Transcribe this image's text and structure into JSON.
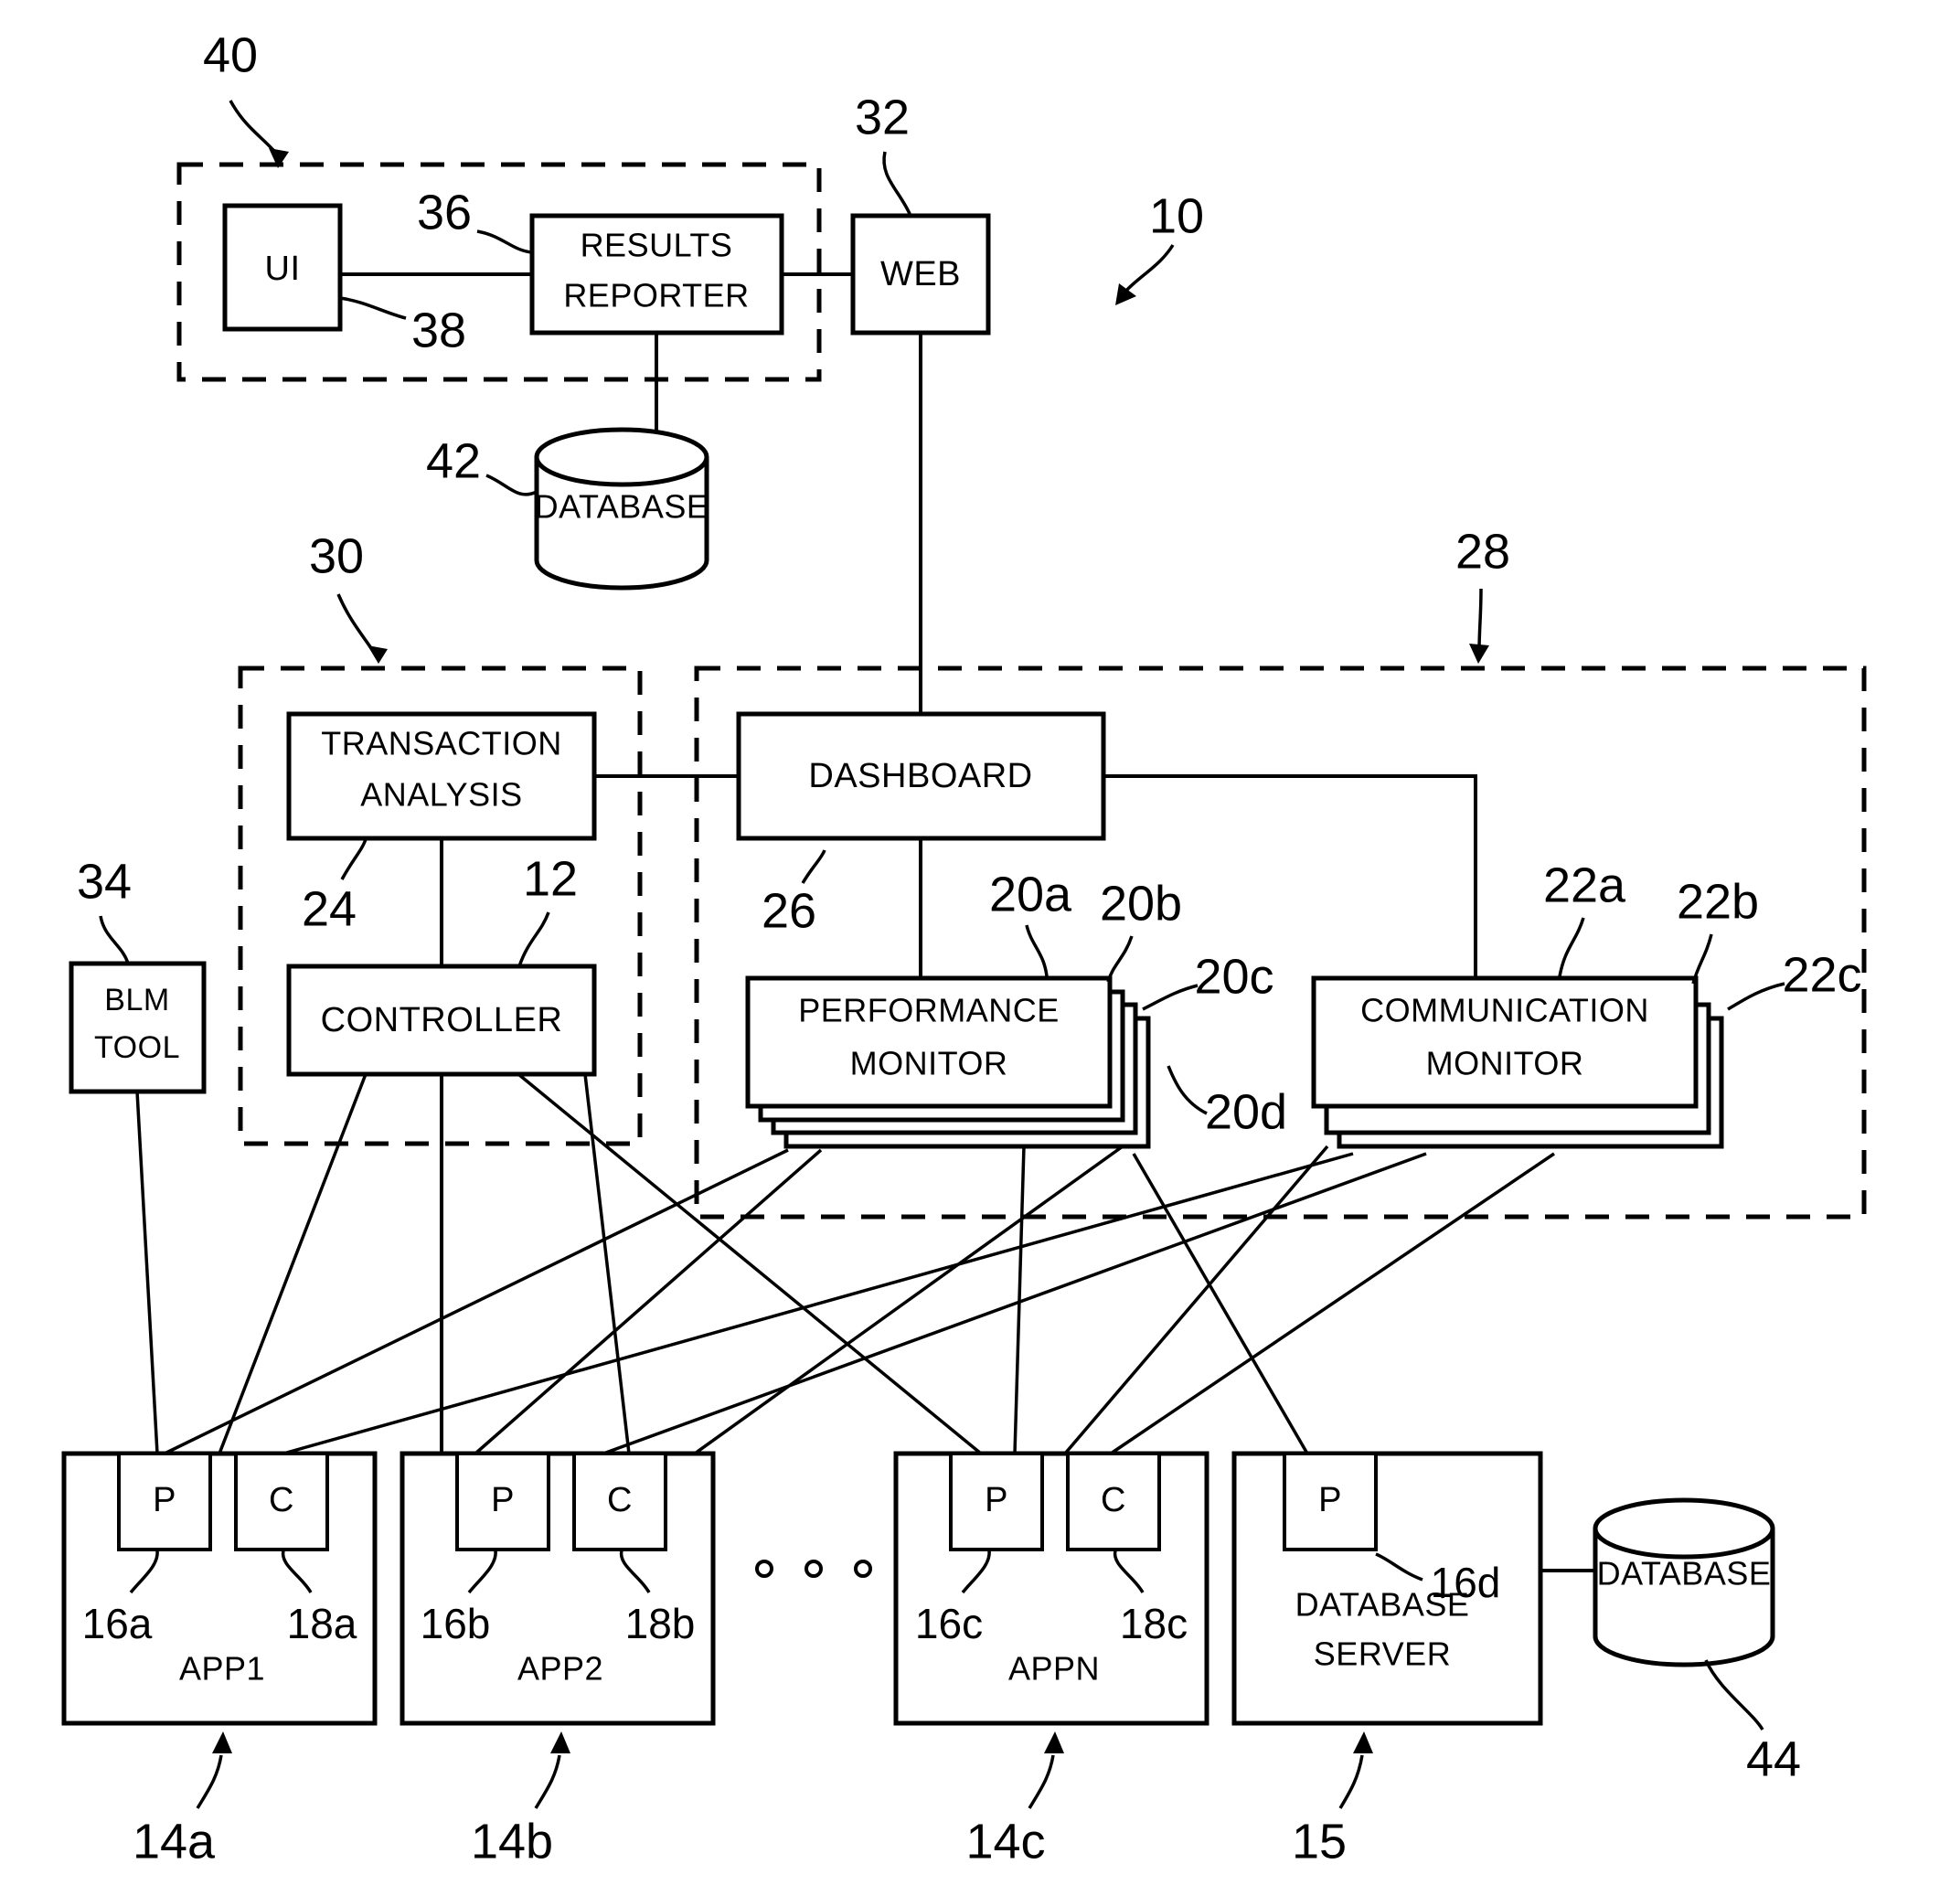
{
  "figure": {
    "type": "patent-block-diagram",
    "overall_ref": "10"
  },
  "boxes": {
    "ui": "UI",
    "results_reporter_line1": "RESULTS",
    "results_reporter_line2": "REPORTER",
    "web": "WEB",
    "database_top": "DATABASE",
    "transaction_analysis_line1": "TRANSACTION",
    "transaction_analysis_line2": "ANALYSIS",
    "dashboard": "DASHBOARD",
    "controller": "CONTROLLER",
    "blm_tool_line1": "BLM",
    "blm_tool_line2": "TOOL",
    "performance_monitor_line1": "PERFORMANCE",
    "performance_monitor_line2": "MONITOR",
    "communication_monitor_line1": "COMMUNICATION",
    "communication_monitor_line2": "MONITOR",
    "app1": "APP1",
    "app2": "APP2",
    "appn": "APPN",
    "database_server_line1": "DATABASE",
    "database_server_line2": "SERVER",
    "database_bottom": "DATABASE",
    "probe": "P",
    "collector": "C"
  },
  "refs": {
    "r10": "10",
    "r12": "12",
    "r14a": "14a",
    "r14b": "14b",
    "r14c": "14c",
    "r15": "15",
    "r16a": "16a",
    "r16b": "16b",
    "r16c": "16c",
    "r16d": "16d",
    "r18a": "18a",
    "r18b": "18b",
    "r18c": "18c",
    "r20a": "20a",
    "r20b": "20b",
    "r20c": "20c",
    "r20d": "20d",
    "r22a": "22a",
    "r22b": "22b",
    "r22c": "22c",
    "r24": "24",
    "r26": "26",
    "r28": "28",
    "r30": "30",
    "r32": "32",
    "r34": "34",
    "r36": "36",
    "r38": "38",
    "r40": "40",
    "r42": "42",
    "r44": "44"
  },
  "probes": {
    "app1_p": "P",
    "app1_c": "C",
    "app2_p": "P",
    "app2_c": "C",
    "appn_p": "P",
    "appn_c": "C",
    "dbserver_p": "P"
  },
  "colors": {
    "ink": "#000000",
    "paper": "#ffffff"
  }
}
